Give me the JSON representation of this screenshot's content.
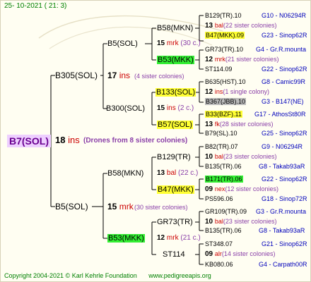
{
  "header": {
    "date_time": "25- 10-2021 ( 21: 3)"
  },
  "footer": {
    "copyright": "Copyright 2004-2021 © Karl Kehrle Foundation",
    "website": "www.pedigreeapis.org"
  },
  "root": {
    "name": "B7(SOL)",
    "count": "18",
    "unit": "ins",
    "note": "(Drones from 8 sister colonies)"
  },
  "gen1": [
    {
      "name": "B305(SOL)",
      "count": "17",
      "unit": "ins",
      "note": "(4 sister colonies)"
    },
    {
      "name": "B5(SOL)",
      "count": "15",
      "unit": "mrk",
      "note": "(30 sister colonies)"
    }
  ],
  "gen2": [
    {
      "name": "B5(SOL)",
      "count": "15",
      "unit": "mrk",
      "note": "(30 c.)"
    },
    {
      "name": "B300(SOL)",
      "count": "15",
      "unit": "ins",
      "note": "(2 c.)"
    },
    {
      "name": "B58(MKN)",
      "count": "13",
      "unit": "bal",
      "note": "(22 c.)"
    },
    {
      "name": "B53(MKK)",
      "count": "12",
      "unit": "mrk",
      "note": "(21 c.)"
    }
  ],
  "gen3": [
    {
      "name": "B58(MKN)",
      "count": "",
      "unit": "",
      "note": ""
    },
    {
      "name": "B53(MKK)",
      "count": "",
      "unit": "",
      "note": ""
    },
    {
      "name": "B133(SOL)",
      "count": "",
      "unit": "",
      "note": ""
    },
    {
      "name": "B57(SOL)",
      "count": "",
      "unit": "",
      "note": ""
    },
    {
      "name": "B129(TR)",
      "count": "",
      "unit": "",
      "note": ""
    },
    {
      "name": "B47(MKK)",
      "count": "",
      "unit": "",
      "note": ""
    },
    {
      "name": "GR73(TR)",
      "count": "",
      "unit": "",
      "note": ""
    },
    {
      "name": "ST114",
      "count": "",
      "unit": "",
      "note": ""
    }
  ],
  "gen4": [
    {
      "name": "B129(TR).10",
      "id": "G10 - N06294R"
    },
    {
      "name": "13 bal(22 sister colonies)",
      "id": ""
    },
    {
      "name": "B47(MKK).09",
      "id": "G23 - Sinop62R"
    },
    {
      "name": "GR73(TR).10",
      "id": "G4 - Gr.R.mounta"
    },
    {
      "name": "12 mrk(21 sister colonies)",
      "id": ""
    },
    {
      "name": "ST114.09",
      "id": "G22 - Sinop62R"
    },
    {
      "name": "B635(HST).10",
      "id": "G8 - Camic99R"
    },
    {
      "name": "12 ins(1 single colony)",
      "id": ""
    },
    {
      "name": "B367(JBB).10",
      "id": "G3 - B147(NE)"
    },
    {
      "name": "B33(BZF).11",
      "id": "G17 - AthosSt80R"
    },
    {
      "name": "13 fk(28 sister colonies)",
      "id": ""
    },
    {
      "name": "B79(SL).10",
      "id": "G25 - Sinop62R"
    },
    {
      "name": "B82(TR).07",
      "id": "G9 - N06294R"
    },
    {
      "name": "10 bal(23 sister colonies)",
      "id": ""
    },
    {
      "name": "B135(TR).06",
      "id": "G8 - Takab93aR"
    },
    {
      "name": "B171(TR).06",
      "id": "G22 - Sinop62R"
    },
    {
      "name": "09 nex(12 sister colonies)",
      "id": ""
    },
    {
      "name": "PS596.06",
      "id": "G18 - Sinop72R"
    },
    {
      "name": "GR109(TR).09",
      "id": "G3 - Gr.R.mounta"
    },
    {
      "name": "10 bal(23 sister colonies)",
      "id": ""
    },
    {
      "name": "B135(TR).06",
      "id": "G8 - Takab93aR"
    },
    {
      "name": "ST348.07",
      "id": "G21 - Sinop62R"
    },
    {
      "name": "09 alr(14 sister colonies)",
      "id": ""
    },
    {
      "name": "KB080.06",
      "id": "G4 - Carpath00R"
    }
  ]
}
